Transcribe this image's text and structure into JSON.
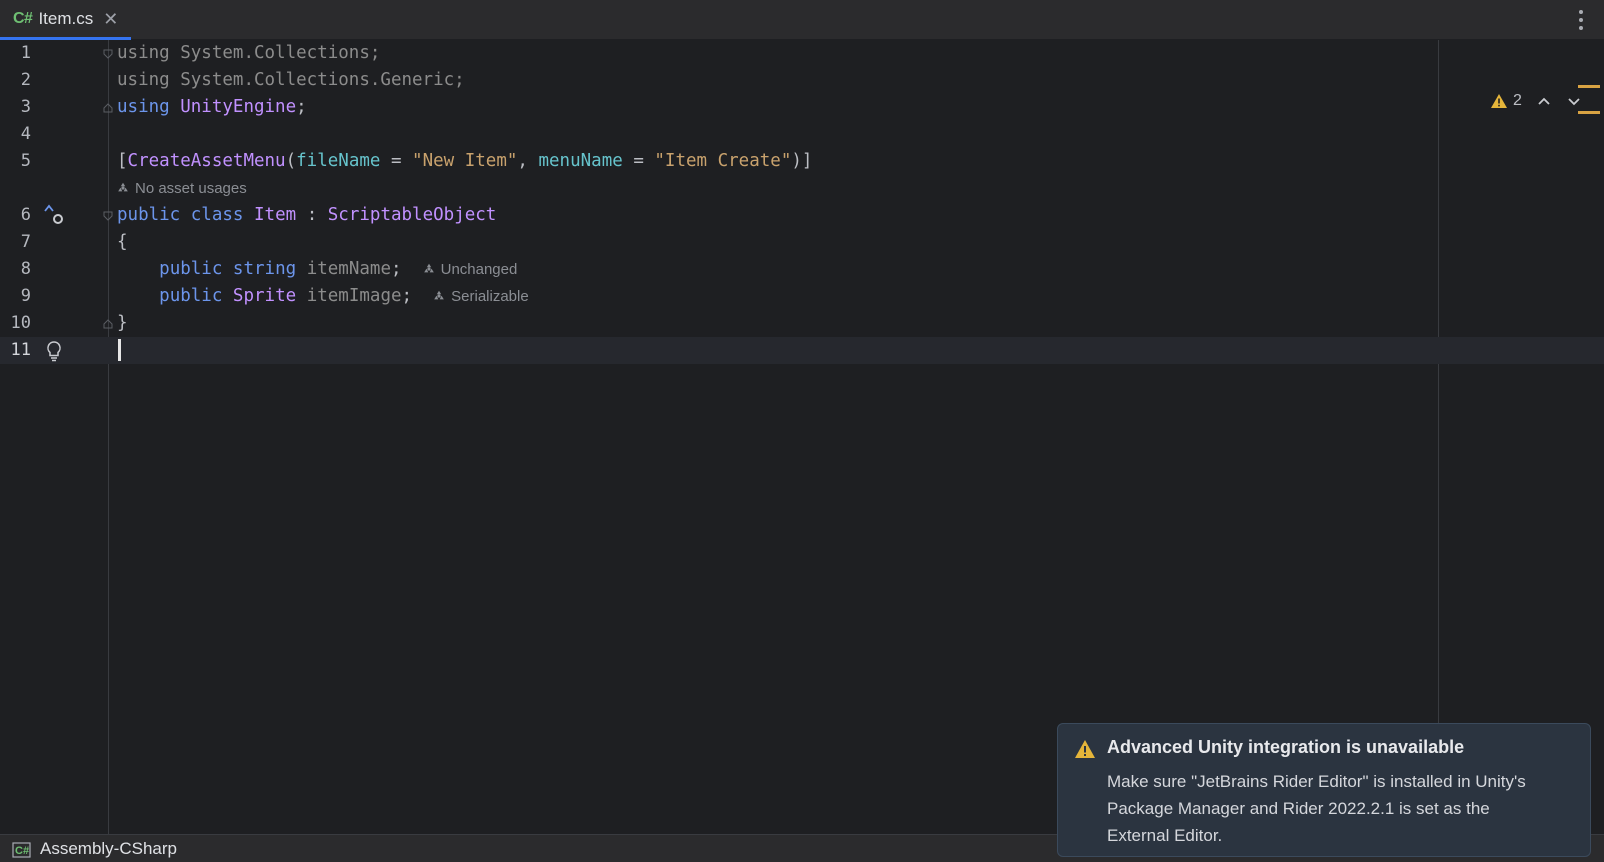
{
  "tab": {
    "lang": "C#",
    "filename": "Item.cs",
    "close": "✕"
  },
  "lines": {
    "n1": "1",
    "n2": "2",
    "n3": "3",
    "n4": "4",
    "n5": "5",
    "n6": "6",
    "n7": "7",
    "n8": "8",
    "n9": "9",
    "n10": "10",
    "n11": "11"
  },
  "code": {
    "l1_kw": "using",
    "l1_rest": " System.Collections;",
    "l2_kw": "using",
    "l2_rest": " System.Collections.Generic;",
    "l3_kw": "using",
    "l3_ns": "UnityEngine",
    "l3_end": ";",
    "l5_open": "[",
    "l5_attr": "CreateAssetMenu",
    "l5_paren": "(",
    "l5_p1": "fileName",
    "l5_eq1": " = ",
    "l5_v1": "\"New Item\"",
    "l5_comma": ", ",
    "l5_p2": "menuName",
    "l5_eq2": " = ",
    "l5_v2": "\"Item Create\"",
    "l5_close": ")]",
    "l6_public": "public",
    "l6_class": "class",
    "l6_name": "Item",
    "l6_colon": " : ",
    "l6_base": "ScriptableObject",
    "l7": "{",
    "l8_public": "public",
    "l8_type": "string",
    "l8_name": "itemName",
    "l8_end": ";",
    "l9_public": "public",
    "l9_type": "Sprite",
    "l9_name": "itemImage",
    "l9_end": ";",
    "l10": "}"
  },
  "hints": {
    "asset_usages": "No asset usages",
    "l8": "Unchanged",
    "l9": "Serializable"
  },
  "inspection": {
    "warning_count": "2"
  },
  "status": {
    "lang": "C#",
    "project": "Assembly-CSharp"
  },
  "notification": {
    "title": "Advanced Unity integration is unavailable",
    "body": "Make sure \"JetBrains Rider Editor\" is installed in Unity's Package Manager and Rider 2022.2.1 is set as the External Editor."
  },
  "colors": {
    "accent": "#3574f0",
    "keyword": "#6c95eb",
    "type": "#c191ff",
    "string": "#c9a26d",
    "param": "#66c3cc",
    "warning": "#e5b53a"
  }
}
